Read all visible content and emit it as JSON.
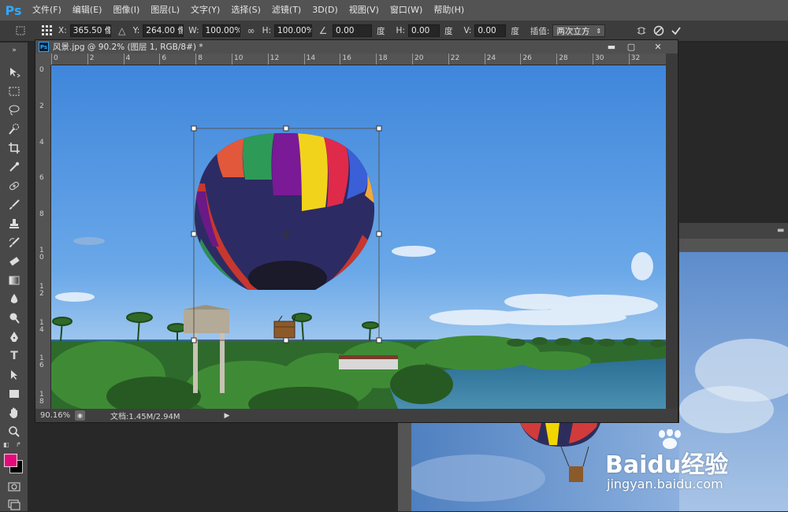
{
  "app": {
    "logo": "Ps"
  },
  "menu": [
    "文件(F)",
    "编辑(E)",
    "图像(I)",
    "图层(L)",
    "文字(Y)",
    "选择(S)",
    "滤镜(T)",
    "3D(D)",
    "视图(V)",
    "窗口(W)",
    "帮助(H)"
  ],
  "options": {
    "x_label": "X:",
    "x_value": "365.50 像",
    "y_label": "Y:",
    "y_value": "264.00 像",
    "w_label": "W:",
    "w_value": "100.00%",
    "h_label": "H:",
    "h_value": "100.00%",
    "angle_value": "0.00",
    "angle_unit": "度",
    "hskew_label": "H:",
    "hskew_value": "0.00",
    "hskew_unit": "度",
    "vskew_label": "V:",
    "vskew_value": "0.00",
    "vskew_unit": "度",
    "interp_label": "插值:",
    "interp_value": "两次立方"
  },
  "document": {
    "title": "风景.jpg @ 90.2% (图层 1, RGB/8#) *",
    "zoom": "90.16%",
    "doc_info": "文档:1.45M/2.94M",
    "ruler_top": [
      "0",
      "2",
      "4",
      "6",
      "8",
      "10",
      "12",
      "14",
      "16",
      "18",
      "20",
      "22",
      "24",
      "26",
      "28",
      "30",
      "32"
    ],
    "ruler_left": [
      "0",
      "2",
      "4",
      "6",
      "8",
      "10",
      "12",
      "14",
      "16",
      "18"
    ]
  },
  "watermark": {
    "brand": "Baidu经验",
    "url": "jingyan.baidu.com"
  },
  "colors": {
    "foreground": "#e5087a",
    "background": "#000000",
    "accent": "#31a8ff"
  }
}
